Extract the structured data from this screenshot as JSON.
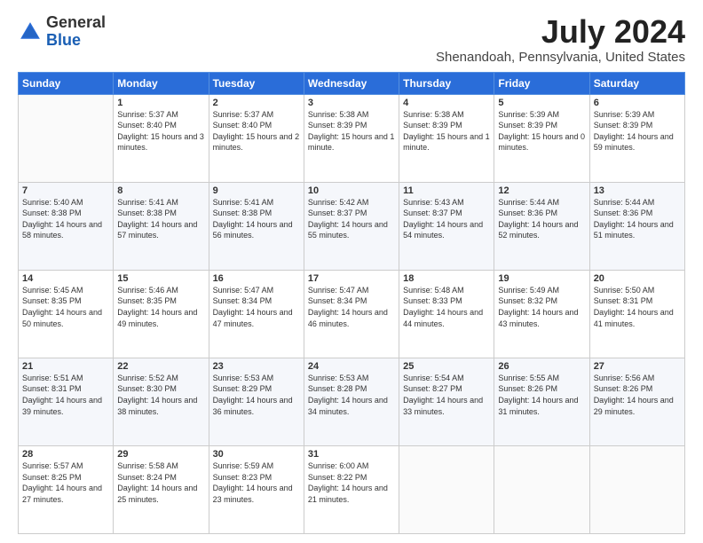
{
  "header": {
    "logo_general": "General",
    "logo_blue": "Blue",
    "month_title": "July 2024",
    "location": "Shenandoah, Pennsylvania, United States"
  },
  "days_of_week": [
    "Sunday",
    "Monday",
    "Tuesday",
    "Wednesday",
    "Thursday",
    "Friday",
    "Saturday"
  ],
  "weeks": [
    [
      {
        "day": "",
        "sunrise": "",
        "sunset": "",
        "daylight": ""
      },
      {
        "day": "1",
        "sunrise": "Sunrise: 5:37 AM",
        "sunset": "Sunset: 8:40 PM",
        "daylight": "Daylight: 15 hours and 3 minutes."
      },
      {
        "day": "2",
        "sunrise": "Sunrise: 5:37 AM",
        "sunset": "Sunset: 8:40 PM",
        "daylight": "Daylight: 15 hours and 2 minutes."
      },
      {
        "day": "3",
        "sunrise": "Sunrise: 5:38 AM",
        "sunset": "Sunset: 8:39 PM",
        "daylight": "Daylight: 15 hours and 1 minute."
      },
      {
        "day": "4",
        "sunrise": "Sunrise: 5:38 AM",
        "sunset": "Sunset: 8:39 PM",
        "daylight": "Daylight: 15 hours and 1 minute."
      },
      {
        "day": "5",
        "sunrise": "Sunrise: 5:39 AM",
        "sunset": "Sunset: 8:39 PM",
        "daylight": "Daylight: 15 hours and 0 minutes."
      },
      {
        "day": "6",
        "sunrise": "Sunrise: 5:39 AM",
        "sunset": "Sunset: 8:39 PM",
        "daylight": "Daylight: 14 hours and 59 minutes."
      }
    ],
    [
      {
        "day": "7",
        "sunrise": "Sunrise: 5:40 AM",
        "sunset": "Sunset: 8:38 PM",
        "daylight": "Daylight: 14 hours and 58 minutes."
      },
      {
        "day": "8",
        "sunrise": "Sunrise: 5:41 AM",
        "sunset": "Sunset: 8:38 PM",
        "daylight": "Daylight: 14 hours and 57 minutes."
      },
      {
        "day": "9",
        "sunrise": "Sunrise: 5:41 AM",
        "sunset": "Sunset: 8:38 PM",
        "daylight": "Daylight: 14 hours and 56 minutes."
      },
      {
        "day": "10",
        "sunrise": "Sunrise: 5:42 AM",
        "sunset": "Sunset: 8:37 PM",
        "daylight": "Daylight: 14 hours and 55 minutes."
      },
      {
        "day": "11",
        "sunrise": "Sunrise: 5:43 AM",
        "sunset": "Sunset: 8:37 PM",
        "daylight": "Daylight: 14 hours and 54 minutes."
      },
      {
        "day": "12",
        "sunrise": "Sunrise: 5:44 AM",
        "sunset": "Sunset: 8:36 PM",
        "daylight": "Daylight: 14 hours and 52 minutes."
      },
      {
        "day": "13",
        "sunrise": "Sunrise: 5:44 AM",
        "sunset": "Sunset: 8:36 PM",
        "daylight": "Daylight: 14 hours and 51 minutes."
      }
    ],
    [
      {
        "day": "14",
        "sunrise": "Sunrise: 5:45 AM",
        "sunset": "Sunset: 8:35 PM",
        "daylight": "Daylight: 14 hours and 50 minutes."
      },
      {
        "day": "15",
        "sunrise": "Sunrise: 5:46 AM",
        "sunset": "Sunset: 8:35 PM",
        "daylight": "Daylight: 14 hours and 49 minutes."
      },
      {
        "day": "16",
        "sunrise": "Sunrise: 5:47 AM",
        "sunset": "Sunset: 8:34 PM",
        "daylight": "Daylight: 14 hours and 47 minutes."
      },
      {
        "day": "17",
        "sunrise": "Sunrise: 5:47 AM",
        "sunset": "Sunset: 8:34 PM",
        "daylight": "Daylight: 14 hours and 46 minutes."
      },
      {
        "day": "18",
        "sunrise": "Sunrise: 5:48 AM",
        "sunset": "Sunset: 8:33 PM",
        "daylight": "Daylight: 14 hours and 44 minutes."
      },
      {
        "day": "19",
        "sunrise": "Sunrise: 5:49 AM",
        "sunset": "Sunset: 8:32 PM",
        "daylight": "Daylight: 14 hours and 43 minutes."
      },
      {
        "day": "20",
        "sunrise": "Sunrise: 5:50 AM",
        "sunset": "Sunset: 8:31 PM",
        "daylight": "Daylight: 14 hours and 41 minutes."
      }
    ],
    [
      {
        "day": "21",
        "sunrise": "Sunrise: 5:51 AM",
        "sunset": "Sunset: 8:31 PM",
        "daylight": "Daylight: 14 hours and 39 minutes."
      },
      {
        "day": "22",
        "sunrise": "Sunrise: 5:52 AM",
        "sunset": "Sunset: 8:30 PM",
        "daylight": "Daylight: 14 hours and 38 minutes."
      },
      {
        "day": "23",
        "sunrise": "Sunrise: 5:53 AM",
        "sunset": "Sunset: 8:29 PM",
        "daylight": "Daylight: 14 hours and 36 minutes."
      },
      {
        "day": "24",
        "sunrise": "Sunrise: 5:53 AM",
        "sunset": "Sunset: 8:28 PM",
        "daylight": "Daylight: 14 hours and 34 minutes."
      },
      {
        "day": "25",
        "sunrise": "Sunrise: 5:54 AM",
        "sunset": "Sunset: 8:27 PM",
        "daylight": "Daylight: 14 hours and 33 minutes."
      },
      {
        "day": "26",
        "sunrise": "Sunrise: 5:55 AM",
        "sunset": "Sunset: 8:26 PM",
        "daylight": "Daylight: 14 hours and 31 minutes."
      },
      {
        "day": "27",
        "sunrise": "Sunrise: 5:56 AM",
        "sunset": "Sunset: 8:26 PM",
        "daylight": "Daylight: 14 hours and 29 minutes."
      }
    ],
    [
      {
        "day": "28",
        "sunrise": "Sunrise: 5:57 AM",
        "sunset": "Sunset: 8:25 PM",
        "daylight": "Daylight: 14 hours and 27 minutes."
      },
      {
        "day": "29",
        "sunrise": "Sunrise: 5:58 AM",
        "sunset": "Sunset: 8:24 PM",
        "daylight": "Daylight: 14 hours and 25 minutes."
      },
      {
        "day": "30",
        "sunrise": "Sunrise: 5:59 AM",
        "sunset": "Sunset: 8:23 PM",
        "daylight": "Daylight: 14 hours and 23 minutes."
      },
      {
        "day": "31",
        "sunrise": "Sunrise: 6:00 AM",
        "sunset": "Sunset: 8:22 PM",
        "daylight": "Daylight: 14 hours and 21 minutes."
      },
      {
        "day": "",
        "sunrise": "",
        "sunset": "",
        "daylight": ""
      },
      {
        "day": "",
        "sunrise": "",
        "sunset": "",
        "daylight": ""
      },
      {
        "day": "",
        "sunrise": "",
        "sunset": "",
        "daylight": ""
      }
    ]
  ]
}
